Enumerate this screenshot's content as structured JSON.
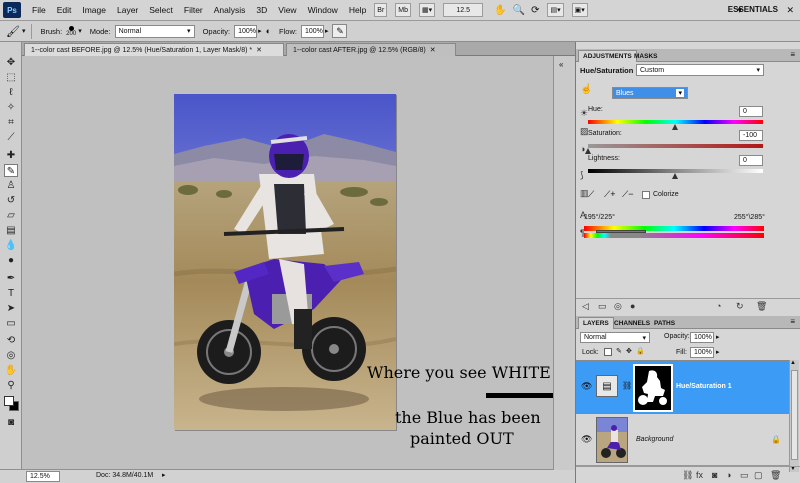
{
  "app": {
    "logo": "Ps"
  },
  "menu": [
    "File",
    "Edit",
    "Image",
    "Layer",
    "Select",
    "Filter",
    "Analysis",
    "3D",
    "View",
    "Window",
    "Help"
  ],
  "menubar": {
    "zoom": "12.5",
    "br_label": "Br",
    "mb_label": "Mb",
    "workspace": "ESSENTIALS"
  },
  "options": {
    "brush_label": "Brush:",
    "brush_size": "200",
    "mode_label": "Mode:",
    "mode_value": "Normal",
    "opacity_label": "Opacity:",
    "opacity_value": "100%",
    "flow_label": "Flow:",
    "flow_value": "100%"
  },
  "tabs": [
    {
      "label": "1--color cast BEFORE.jpg @ 12.5% (Hue/Saturation 1, Layer Mask/8) *"
    },
    {
      "label": "1--color cast AFTER.jpg @ 12.5% (RGB/8)"
    }
  ],
  "status": {
    "zoom": "12.5%",
    "doc": "Doc: 34.8M/40.1M"
  },
  "adjustments": {
    "tab_adjustments": "ADJUSTMENTS",
    "tab_masks": "MASKS",
    "title": "Hue/Saturation",
    "preset": "Custom",
    "channel": "Blues",
    "hue_label": "Hue:",
    "hue_value": "0",
    "saturation_label": "Saturation:",
    "saturation_value": "-100",
    "lightness_label": "Lightness:",
    "lightness_value": "0",
    "colorize_label": "Colorize",
    "range_left": "195°/225°",
    "range_right": "255°\\285°"
  },
  "layers": {
    "tab_layers": "LAYERS",
    "tab_channels": "CHANNELS",
    "tab_paths": "PATHS",
    "blend_mode": "Normal",
    "opacity_label": "Opacity:",
    "opacity_value": "100%",
    "lock_label": "Lock:",
    "fill_label": "Fill:",
    "fill_value": "100%",
    "items": [
      {
        "name": "Hue/Saturation 1"
      },
      {
        "name": "Background"
      }
    ]
  },
  "annotation": {
    "line1": "Where you see WHITE",
    "line2": "the Blue has been",
    "line3": "painted OUT"
  },
  "colors": {
    "accent_selection": "#3c9bf5",
    "channel_field": "#3f8fe8",
    "bike_purple": "#4b1fb0"
  }
}
